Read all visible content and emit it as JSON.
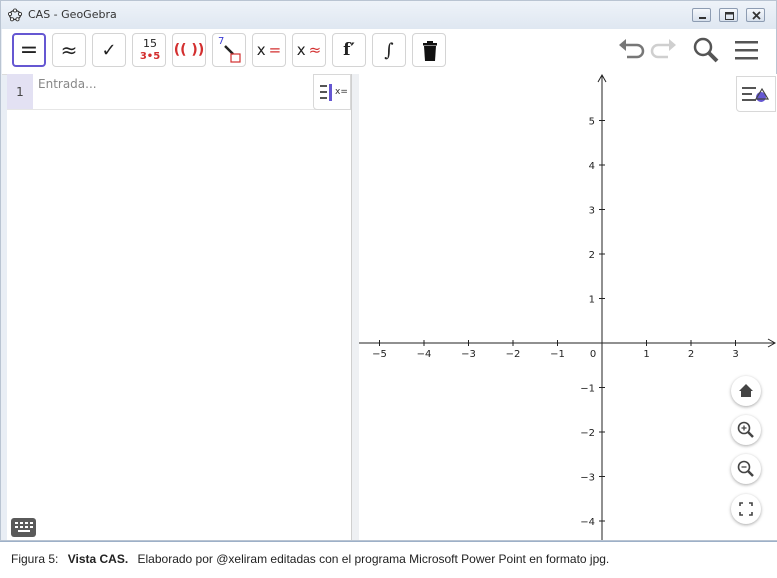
{
  "window": {
    "title": "CAS - GeoGebra"
  },
  "toolbar": {
    "tools": [
      {
        "name": "evaluate",
        "label": "="
      },
      {
        "name": "numeric",
        "label": "≈"
      },
      {
        "name": "keep-input",
        "label": "✓"
      },
      {
        "name": "factor-top",
        "label": "15"
      },
      {
        "name": "factor-bottom",
        "label": "3•5"
      },
      {
        "name": "expand",
        "label": "(( ))"
      },
      {
        "name": "substitute",
        "label": "7"
      },
      {
        "name": "solve-x",
        "label": "x"
      },
      {
        "name": "solve-eq",
        "label": "="
      },
      {
        "name": "nsolve-x",
        "label": "x"
      },
      {
        "name": "nsolve-eq",
        "label": "≈"
      },
      {
        "name": "derivative",
        "label": "f′"
      },
      {
        "name": "integral",
        "label": "∫"
      }
    ]
  },
  "cas": {
    "rows": [
      {
        "number": "1",
        "placeholder": "Entrada..."
      }
    ],
    "side_label": "x="
  },
  "graphics": {
    "x_ticks": [
      "−5",
      "−4",
      "−3",
      "−2",
      "−1",
      "0",
      "1",
      "2",
      "3"
    ],
    "y_ticks_pos": [
      "5",
      "4",
      "3",
      "2",
      "1"
    ],
    "y_ticks_neg": [
      "−1",
      "−2",
      "−3",
      "−4"
    ],
    "xlim": [
      -5.5,
      3.9
    ],
    "ylim": [
      -4.5,
      6.0
    ]
  },
  "caption": {
    "figure_label": "Figura 5:",
    "title": "Vista CAS.",
    "text": "Elaborado por @xeliram editadas con el programa Microsoft Power Point en formato jpg."
  },
  "colors": {
    "accent": "#6557d2",
    "red": "#d32f2f",
    "row_highlight": "#e3e1f3"
  }
}
